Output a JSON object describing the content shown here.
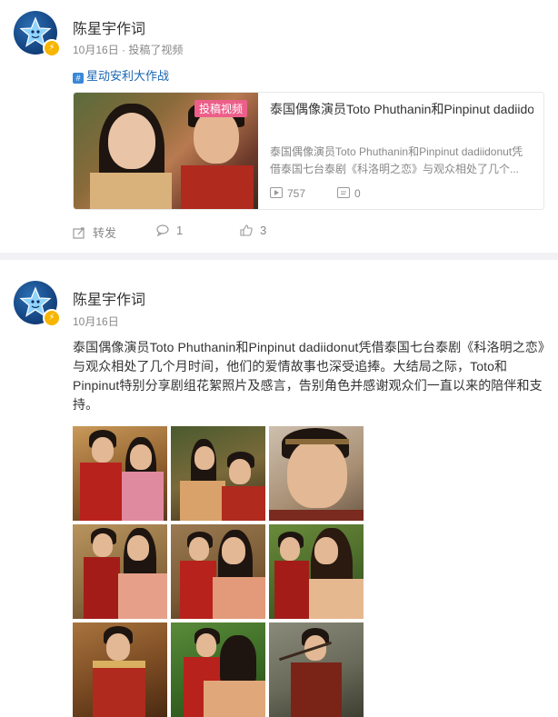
{
  "post1": {
    "username": "陈星宇作词",
    "meta": "10月16日 · 投稿了视频",
    "topic": "星动安利大作战",
    "card": {
      "badge": "投稿视频",
      "title": "泰国偶像演员Toto Phuthanin和Pinpinut dadiidonut凭借泰国七台泰剧《科洛明之恋》与观...",
      "description": "泰国偶像演员Toto Phuthanin和Pinpinut dadiidonut凭借泰国七台泰剧《科洛明之恋》与观众相处了几个...",
      "plays": "757",
      "comments": "0"
    },
    "actions": {
      "repost": "转发",
      "comment": "1",
      "like": "3"
    }
  },
  "post2": {
    "username": "陈星宇作词",
    "meta": "10月16日",
    "text": "泰国偶像演员Toto Phuthanin和Pinpinut dadiidonut凭借泰国七台泰剧《科洛明之恋》与观众相处了几个月时间，他们的爱情故事也深受追捧。大结局之际，Toto和Pinpinut特别分享剧组花絮照片及感言，告别角色并感谢观众们一直以来的陪伴和支持。",
    "photo_count": 9
  },
  "colors": {
    "link": "#1a66b3",
    "badge_pink": "#ec5f89",
    "verified_gold": "#f7b500",
    "divider": "#f2f2f5",
    "muted": "#888888"
  },
  "icons": {
    "verified": "lightning-badge-icon",
    "topic": "topic-icon",
    "play": "play-icon",
    "comment_box": "comment-icon",
    "repost": "repost-icon",
    "like": "thumbs-up-icon"
  }
}
